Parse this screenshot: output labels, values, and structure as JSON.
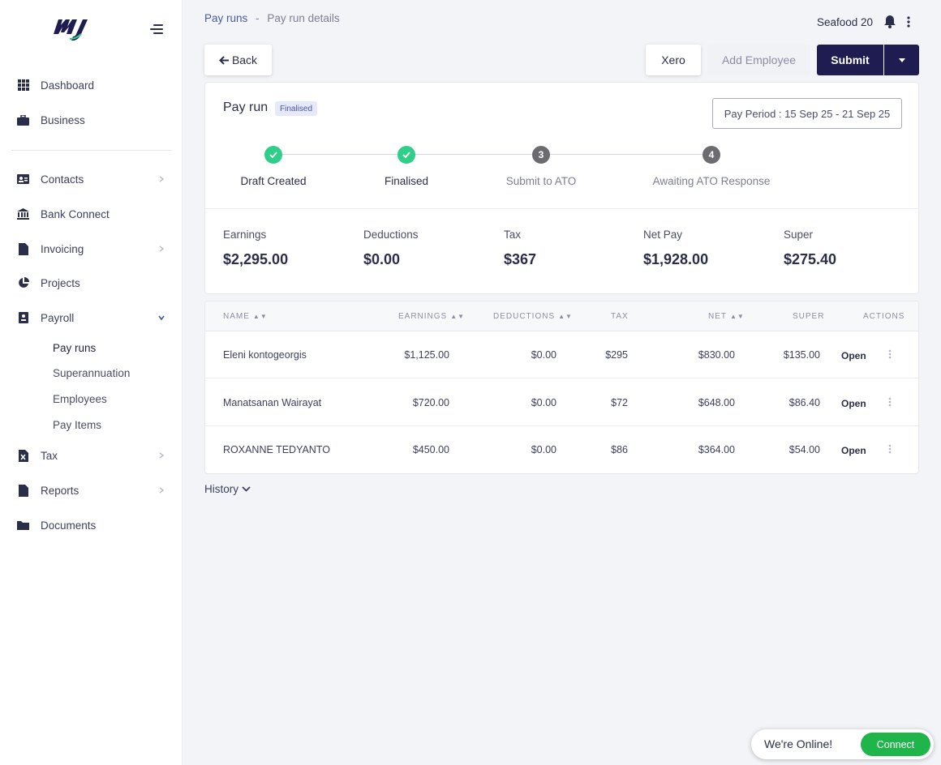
{
  "sidebar": {
    "logo_icon": "my-logo-icon",
    "menu_icon": "hamburger-icon",
    "items": [
      {
        "label": "Dashboard",
        "icon": "grid-icon"
      },
      {
        "label": "Business",
        "icon": "briefcase-icon"
      },
      {
        "label": "Contacts",
        "icon": "contact-card-icon"
      },
      {
        "label": "Bank Connect",
        "icon": "bank-icon"
      },
      {
        "label": "Invoicing",
        "icon": "document-icon"
      },
      {
        "label": "Projects",
        "icon": "pie-chart-icon"
      },
      {
        "label": "Payroll",
        "icon": "payroll-icon"
      },
      {
        "label": "Tax",
        "icon": "tax-file-icon"
      },
      {
        "label": "Reports",
        "icon": "report-icon"
      },
      {
        "label": "Documents",
        "icon": "folder-icon"
      }
    ],
    "payroll_sub": [
      "Pay runs",
      "Superannuation",
      "Employees",
      "Pay Items"
    ]
  },
  "breadcrumb": {
    "root": "Pay runs",
    "separator": "-",
    "current": "Pay run details"
  },
  "header": {
    "org": "Seafood 20"
  },
  "toolbar": {
    "back": "Back",
    "xero": "Xero",
    "add_employee": "Add Employee",
    "submit": "Submit"
  },
  "payrun": {
    "title": "Pay run",
    "status": "Finalised",
    "period": "Pay Period : 15 Sep 25 - 21 Sep 25",
    "steps": [
      {
        "number": "",
        "label": "Draft Created",
        "done": true
      },
      {
        "number": "",
        "label": "Finalised",
        "done": true
      },
      {
        "number": "3",
        "label": "Submit to ATO",
        "done": false
      },
      {
        "number": "4",
        "label": "Awaiting ATO Response",
        "done": false
      }
    ],
    "summary": [
      {
        "label": "Earnings",
        "value": "$2,295.00"
      },
      {
        "label": "Deductions",
        "value": "$0.00"
      },
      {
        "label": "Tax",
        "value": "$367"
      },
      {
        "label": "Net Pay",
        "value": "$1,928.00"
      },
      {
        "label": "Super",
        "value": "$275.40"
      }
    ]
  },
  "table": {
    "headers": [
      "NAME",
      "EARNINGS",
      "DEDUCTIONS",
      "TAX",
      "NET",
      "SUPER",
      "ACTIONS"
    ],
    "rows": [
      {
        "name": "Eleni kontogeorgis",
        "earnings": "$1,125.00",
        "deductions": "$0.00",
        "tax": "$295",
        "net": "$830.00",
        "super": "$135.00",
        "action": "Open"
      },
      {
        "name": "Manatsanan Wairayat",
        "earnings": "$720.00",
        "deductions": "$0.00",
        "tax": "$72",
        "net": "$648.00",
        "super": "$86.40",
        "action": "Open"
      },
      {
        "name": "ROXANNE TEDYANTO",
        "earnings": "$450.00",
        "deductions": "$0.00",
        "tax": "$86",
        "net": "$364.00",
        "super": "$54.00",
        "action": "Open"
      }
    ]
  },
  "history": {
    "label": "History"
  },
  "chat": {
    "text": "We're Online!",
    "button": "Connect"
  },
  "colors": {
    "brand": "#1f1c52",
    "success": "#2fcf8a",
    "chat_green": "#1fb54a"
  }
}
